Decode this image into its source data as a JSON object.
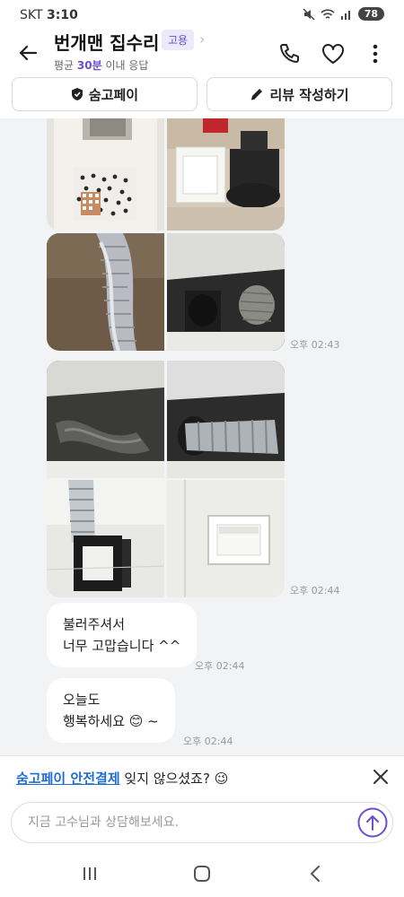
{
  "status_bar": {
    "carrier": "SKT",
    "time": "3:10",
    "battery": "78"
  },
  "header": {
    "title": "번개맨 집수리",
    "badge": "고용",
    "response_prefix": "평균 ",
    "response_highlight": "30분",
    "response_suffix": " 이내 응답",
    "accent_color": "#6a4fd3"
  },
  "actions": {
    "pay_label": "숨고페이",
    "review_label": "리뷰 작성하기"
  },
  "chat": {
    "groups": [
      {
        "time": "오후 02:43"
      },
      {
        "time": "오후 02:44"
      }
    ],
    "messages": [
      {
        "line1": "불러주셔서",
        "line2": "너무 고맙습니다 ^^",
        "time": "오후 02:44"
      },
      {
        "line1": "오늘도",
        "line2": "행복하세요 😊 ~",
        "time": "오후 02:44"
      }
    ]
  },
  "notice": {
    "link_text": "숨고페이 안전결제",
    "rest_text": " 잊지 않으셨죠? 😉",
    "link_color": "#1f6dd1"
  },
  "composer": {
    "placeholder": "지금 고수님과 상담해보세요."
  },
  "icons": {
    "back": "back-arrow-icon",
    "phone": "phone-icon",
    "heart": "heart-icon",
    "more": "more-vertical-icon",
    "shield": "shield-icon",
    "pencil": "pencil-icon",
    "close": "close-icon",
    "send": "send-arrow-icon",
    "recents": "recents-icon",
    "home": "home-icon",
    "nav_back": "nav-back-icon"
  }
}
